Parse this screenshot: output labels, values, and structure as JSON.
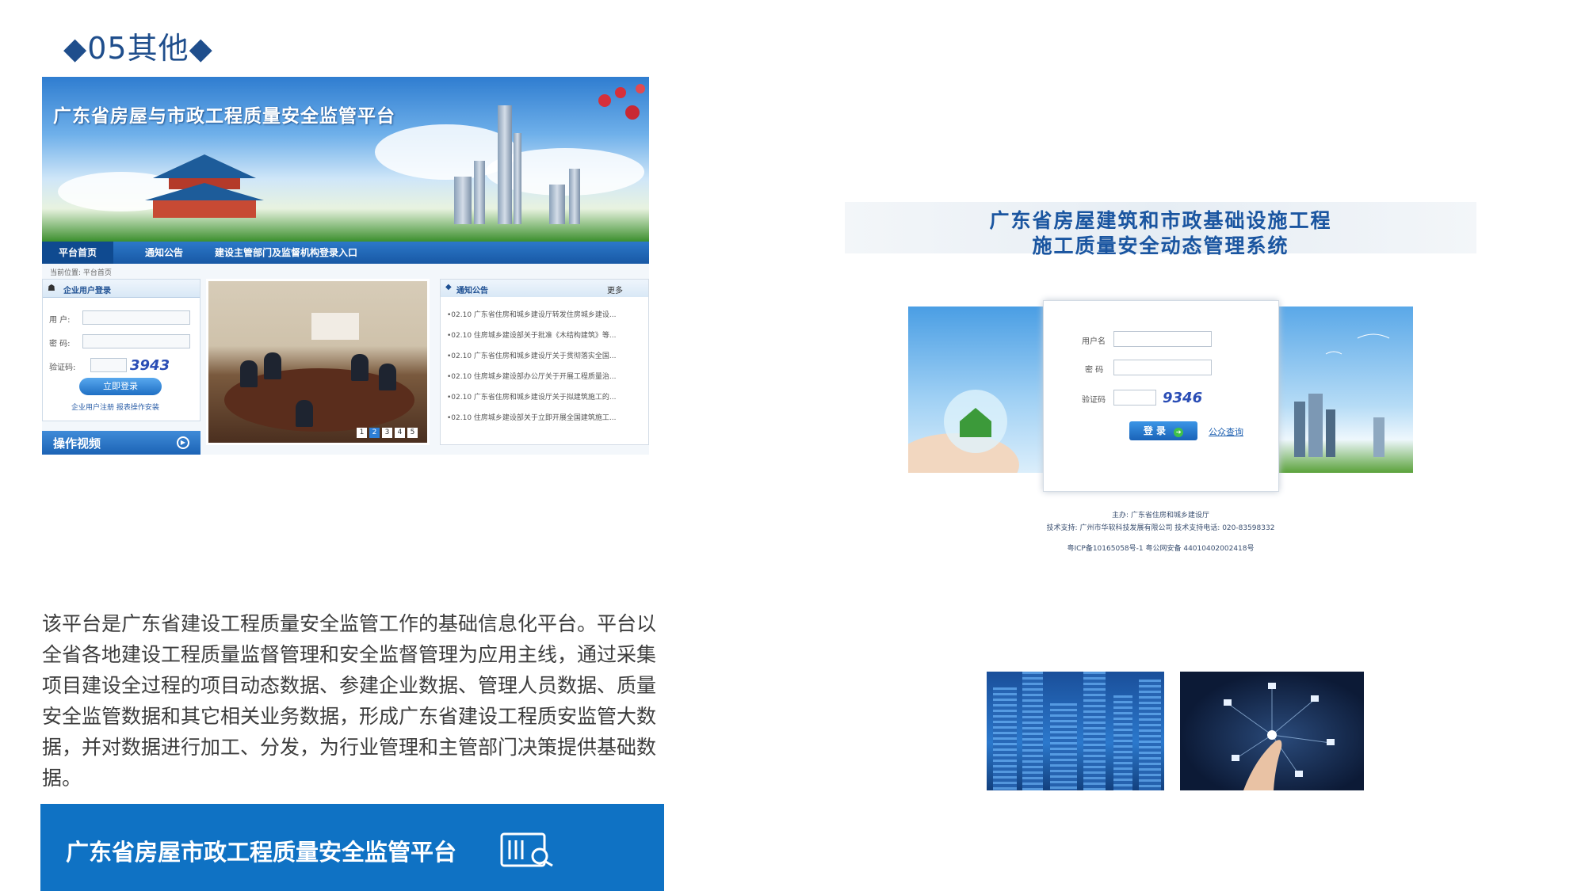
{
  "section": {
    "title": "◆05其他◆"
  },
  "left_screenshot": {
    "banner_title": "广东省房屋与市政工程质量安全监管平台",
    "nav": [
      "平台首页",
      "通知公告",
      "建设主管部门及监督机构登录入口"
    ],
    "breadcrumb": "当前位置: 平台首页",
    "login": {
      "title": "企业用户登录",
      "user_label": "用 户:",
      "password_label": "密 码:",
      "captcha_label": "验证码:",
      "captcha": "3943",
      "button": "立即登录",
      "links": "企业用户注册    报表操作安装"
    },
    "video": "操作视频",
    "slider_pages": [
      "1",
      "2",
      "3",
      "4",
      "5"
    ],
    "notice": {
      "title": "通知公告",
      "more": "更多",
      "items": [
        "•02.10  广东省住房和城乡建设厅转发住房城乡建设...",
        "•02.10  住房城乡建设部关于批准《木结构建筑》等...",
        "•02.10  广东省住房和城乡建设厅关于贯彻落实全国...",
        "•02.10  住房城乡建设部办公厅关于开展工程质量治...",
        "•02.10  广东省住房和城乡建设厅关于拟建筑施工的...",
        "•02.10  住房城乡建设部关于立即开展全国建筑施工..."
      ]
    }
  },
  "right_screenshot": {
    "title_line1": "广东省房屋建筑和市政基础设施工程",
    "title_line2": "施工质量安全动态管理系统",
    "username_label": "用户名",
    "password_label": "密  码",
    "captcha_label": "验证码",
    "captcha": "9346",
    "login_button": "登 录",
    "public_query": "公众查询",
    "footer": [
      "主办: 广东省住房和城乡建设厅",
      "技术支持: 广州市华软科技发展有限公司    技术支持电话: 020-83598332",
      "粤ICP备10165058号-1    粤公网安备 44010402002418号"
    ]
  },
  "description": "该平台是广东省建设工程质量安全监管工作的基础信息化平台。平台以全省各地建设工程质量监督管理和安全监督管理为应用主线，通过采集项目建设全过程的项目动态数据、参建企业数据、管理人员数据、质量安全监管数据和其它相关业务数据，形成广东省建设工程质安监管大数据，并对数据进行加工、分发，为行业管理和主管部门决策提供基础数据。",
  "bottom_bar": {
    "title": "广东省房屋市政工程质量安全监管平台"
  },
  "colors": {
    "brand_blue": "#0f72c4",
    "title_blue": "#1f4e8c"
  }
}
